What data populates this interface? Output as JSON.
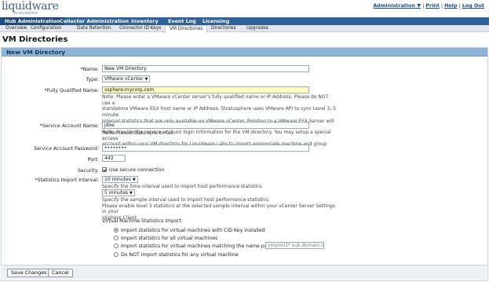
{
  "brand": {
    "name": "liquidware",
    "tagline": "Stratusphere"
  },
  "toplinks": {
    "admin": "Administration ▼",
    "print": "Print",
    "help": "Help",
    "logout": "Log Out",
    "separator": "|"
  },
  "mainnav": [
    "Hub Administration",
    "Collector Administration",
    "Inventory",
    "Event Log",
    "Licensing"
  ],
  "subnav": [
    "Overview",
    "Configuration",
    "Data Retention",
    "Connector ID Keys",
    "VM Directories",
    "Directories",
    "Upgrades"
  ],
  "page": {
    "title": "VM Directories",
    "panel_title": "New VM Directory"
  },
  "form": {
    "name": {
      "label": "*Name:",
      "value": "New VM Directory"
    },
    "type": {
      "label": "Type:",
      "value": "VMware vCenter",
      "caret": "▼"
    },
    "fqdn": {
      "label": "*Fully Qualified Name:",
      "value": "vsphere.mycorp.com",
      "note": [
        "Note: Please enter a VMware vCenter server's fully qualified name or IP Address. Please do NOT use a",
        "standalone VMware ESX host name or IP Address. Stratusphere uses VMware API to sync Level 3, 5 minute",
        "interval statistics that are only available on VMware vCenter. Pointing to a VMware ESX Server will cause the",
        "Performance Stats sync to fail."
      ]
    },
    "account": {
      "label": "*Service Account Name:",
      "value": "jdoe",
      "note": [
        "Note: Provide the service account login information for the VM directory. You may setup a special access",
        "account within your VM directory for Liquidware Labs to import appropriate machine and group information."
      ]
    },
    "password": {
      "label": "Service Account Password:",
      "value": "••••••••"
    },
    "port": {
      "label": "Port:",
      "value": "443"
    },
    "security": {
      "label": "Security:",
      "option": "Use secure connection"
    },
    "interval": {
      "label": "*Statistics Import Interval:",
      "host_value": "10 minutes",
      "host_note": "Specify the time interval used to import host performance statistics.",
      "sample_value": "5 minutes",
      "sample_note": [
        "Specify the sample interval used to import host performance statistics.",
        "Please enable level 3 statistics at the selected sample interval within your vCenter Server Settings in your",
        "vSphere Client."
      ]
    },
    "vm_stats": {
      "heading": "Virtual Machine Statistics Import:",
      "options": [
        "Import statistics for virtual machines with CID Key installed",
        "Import statistics for all virtual machines",
        "Import statistics for virtual machines matching the name pattern",
        "Do NOT import statistics for any virtual machine"
      ],
      "pattern_value": "vmpool1*.sub.domain.com"
    }
  },
  "buttons": {
    "save": "Save Changes",
    "cancel": "Cancel"
  }
}
